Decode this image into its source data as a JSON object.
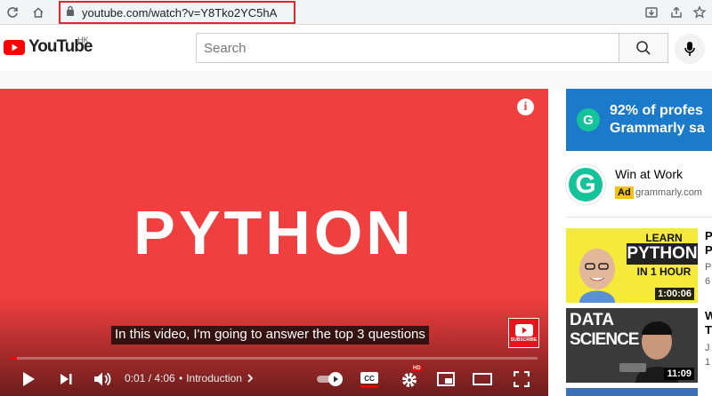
{
  "browser": {
    "url": "youtube.com/watch?v=Y8Tko2YC5hA"
  },
  "header": {
    "logo_text": "YouTube",
    "region": "HK",
    "search_placeholder": "Search"
  },
  "player": {
    "title_overlay": "PYTHON",
    "caption": "In this video, I'm going to answer the top 3 questions",
    "time": "0:01 / 4:06",
    "chapter_separator": "•",
    "chapter": "Introduction",
    "subscribe_label": "SUBSCRIBE",
    "hd_badge": "HD",
    "progress_fraction": 0.004,
    "accent_color": "#ef3f3e"
  },
  "sidebar": {
    "ad_banner_line1": "92% of profes",
    "ad_banner_line2": "Grammarly sa",
    "ad_title": "Win at Work",
    "ad_badge": "Ad",
    "ad_domain": "grammarly.com",
    "recommendations": [
      {
        "thumb_line1": "LEARN",
        "thumb_line2": "PYTHON",
        "thumb_line3": "IN 1 HOUR",
        "duration": "1:00:06",
        "title_fragment": "P",
        "title_fragment2": "P",
        "channel_fragment": "P",
        "views_fragment": "6"
      },
      {
        "thumb_line1": "DATA",
        "thumb_line2": "SCIENCE",
        "duration": "11:09",
        "title_fragment": "W",
        "title_fragment2": "T",
        "channel_fragment": "J",
        "views_fragment": "1"
      }
    ]
  }
}
